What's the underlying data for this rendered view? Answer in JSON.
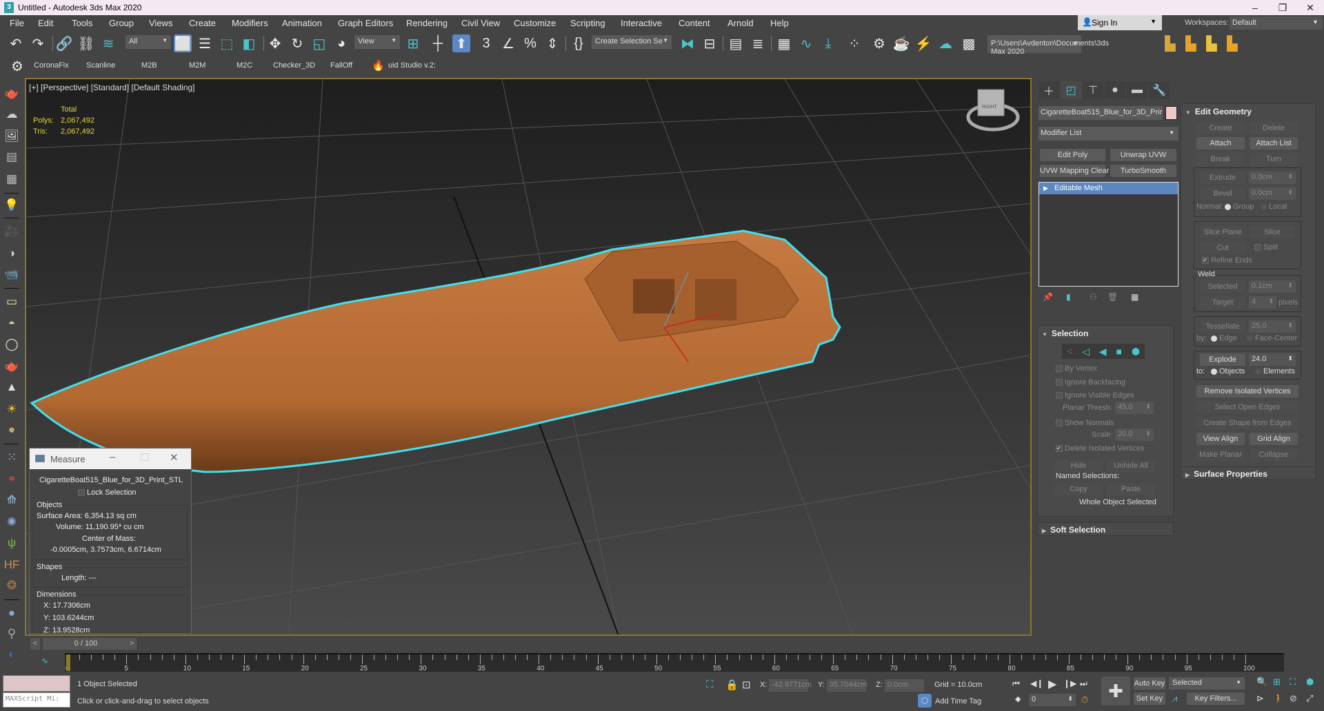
{
  "window": {
    "title": "Untitled - Autodesk 3ds Max 2020",
    "logo": "3",
    "controls": [
      "minimize-icon",
      "restore-icon",
      "close-icon"
    ]
  },
  "menu": [
    "File",
    "Edit",
    "Tools",
    "Group",
    "Views",
    "Create",
    "Modifiers",
    "Animation",
    "Graph Editors",
    "Rendering",
    "Civil View",
    "Customize",
    "Scripting",
    "Interactive",
    "Content",
    "Arnold",
    "Help"
  ],
  "account": {
    "sign_in": "Sign In",
    "workspaces_label": "Workspaces:",
    "workspace": "Default"
  },
  "main_toolbar": {
    "selection_filter": "All",
    "ref_coord": "View",
    "named_selection": "Create Selection Se",
    "project_path": "P:\\Users\\Avdenton\\Documents\\3ds Max 2020"
  },
  "custom_toolbar": [
    "CoronaFix",
    "Scanline",
    "M2B",
    "M2M",
    "M2C",
    "Checker_3D",
    "FallOff",
    "uid Studio v.2:"
  ],
  "viewport": {
    "label": "[+] [Perspective] [Standard] [Default Shading]",
    "stats": {
      "header": "Total",
      "polys_label": "Polys:",
      "polys": "2,067,492",
      "tris_label": "Tris:",
      "tris": "2,067,492"
    },
    "viewcube_face": "RIGHT",
    "colors": {
      "boat": "#b86a35",
      "selection_outline": "#3fe0f0",
      "grid_bg": "#2a2a2a",
      "border": "#8a7530"
    }
  },
  "measure": {
    "title": "Measure",
    "object": "CigaretteBoat515_Blue_for_3D_Print_STL",
    "lock_selection": "Lock Selection",
    "objects_group": "Objects",
    "surface_area": "Surface Area: 6,354.13 sq cm",
    "volume": "Volume:  11,190.95* cu cm",
    "center_label": "Center of Mass:",
    "center_value": "-0.0005cm, 3.7573cm, 6.6714cm",
    "shapes_group": "Shapes",
    "length": "Length: ---",
    "dimensions_group": "Dimensions",
    "dim_x": "X:   17.7306cm",
    "dim_y": "Y:   103.6244cm",
    "dim_z": "Z:   13.9528cm"
  },
  "command_panel": {
    "object_name": "CigaretteBoat515_Blue_for_3D_Prin",
    "object_color": "#f0c8c8",
    "modifier_list": "Modifier List",
    "mod_buttons": [
      "Edit Poly",
      "Unwrap UVW",
      "UVW Mapping Clear",
      "TurboSmooth"
    ],
    "stack": [
      "Editable Mesh"
    ],
    "selection": {
      "title": "Selection",
      "by_vertex": "By Vertex",
      "ignore_backfacing": "Ignore Backfacing",
      "ignore_visible_edges": "Ignore Visible Edges",
      "planar_thresh_label": "Planar Thresh:",
      "planar_thresh": "45.0",
      "show_normals": "Show Normals",
      "scale_label": "Scale:",
      "scale": "20.0",
      "delete_isolated": "Delete Isolated Vertices",
      "hide": "Hide",
      "unhide_all": "Unhide All",
      "named_selections": "Named Selections:",
      "copy": "Copy",
      "paste": "Paste",
      "status": "Whole Object Selected"
    },
    "soft_selection": "Soft Selection",
    "edit_geometry": {
      "title": "Edit Geometry",
      "create": "Create",
      "delete": "Delete",
      "attach": "Attach",
      "attach_list": "Attach List",
      "break": "Break",
      "turn": "Turn",
      "extrude": "Extrude",
      "extrude_val": "0.0cm",
      "bevel": "Bevel",
      "bevel_val": "0.0cm",
      "normal_label": "Normal:",
      "group": "Group",
      "local": "Local",
      "slice_plane": "Slice Plane",
      "slice": "Slice",
      "cut": "Cut",
      "split": "Split",
      "refine_ends": "Refine Ends",
      "weld": "Weld",
      "selected": "Selected",
      "selected_val": "0.1cm",
      "target": "Target",
      "target_val": "4",
      "pixels": "pixels",
      "tessellate": "Tessellate",
      "tessellate_val": "25.0",
      "by_label": "by:",
      "edge": "Edge",
      "face_center": "Face-Center",
      "explode": "Explode",
      "explode_val": "24.0",
      "to_label": "to:",
      "objects": "Objects",
      "elements": "Elements",
      "remove_isolated": "Remove Isolated Vertices",
      "select_open_edges": "Select Open Edges",
      "create_shape": "Create Shape from Edges",
      "view_align": "View Align",
      "grid_align": "Grid Align",
      "make_planar": "Make Planar",
      "collapse": "Collapse"
    },
    "surface_properties": "Surface Properties"
  },
  "timeline": {
    "frame": "0 / 100",
    "ticks": [
      "0",
      "5",
      "10",
      "15",
      "20",
      "25",
      "30",
      "35",
      "40",
      "45",
      "50",
      "55",
      "60",
      "65",
      "70",
      "75",
      "80",
      "85",
      "90",
      "95",
      "100"
    ]
  },
  "status": {
    "selected": "1 Object Selected",
    "prompt": "Click or click-and-drag to select objects",
    "maxscript": "MAXScript Mi:",
    "x_label": "X:",
    "x": "-42.9771cm",
    "y_label": "Y:",
    "y": "35.7044cm",
    "z_label": "Z:",
    "z": "0.0cm",
    "grid": "Grid = 10.0cm",
    "add_time_tag": "Add Time Tag",
    "current_frame": "0",
    "auto_key": "Auto Key",
    "set_key": "Set Key",
    "key_mode": "Selected",
    "key_filters": "Key Filters..."
  }
}
